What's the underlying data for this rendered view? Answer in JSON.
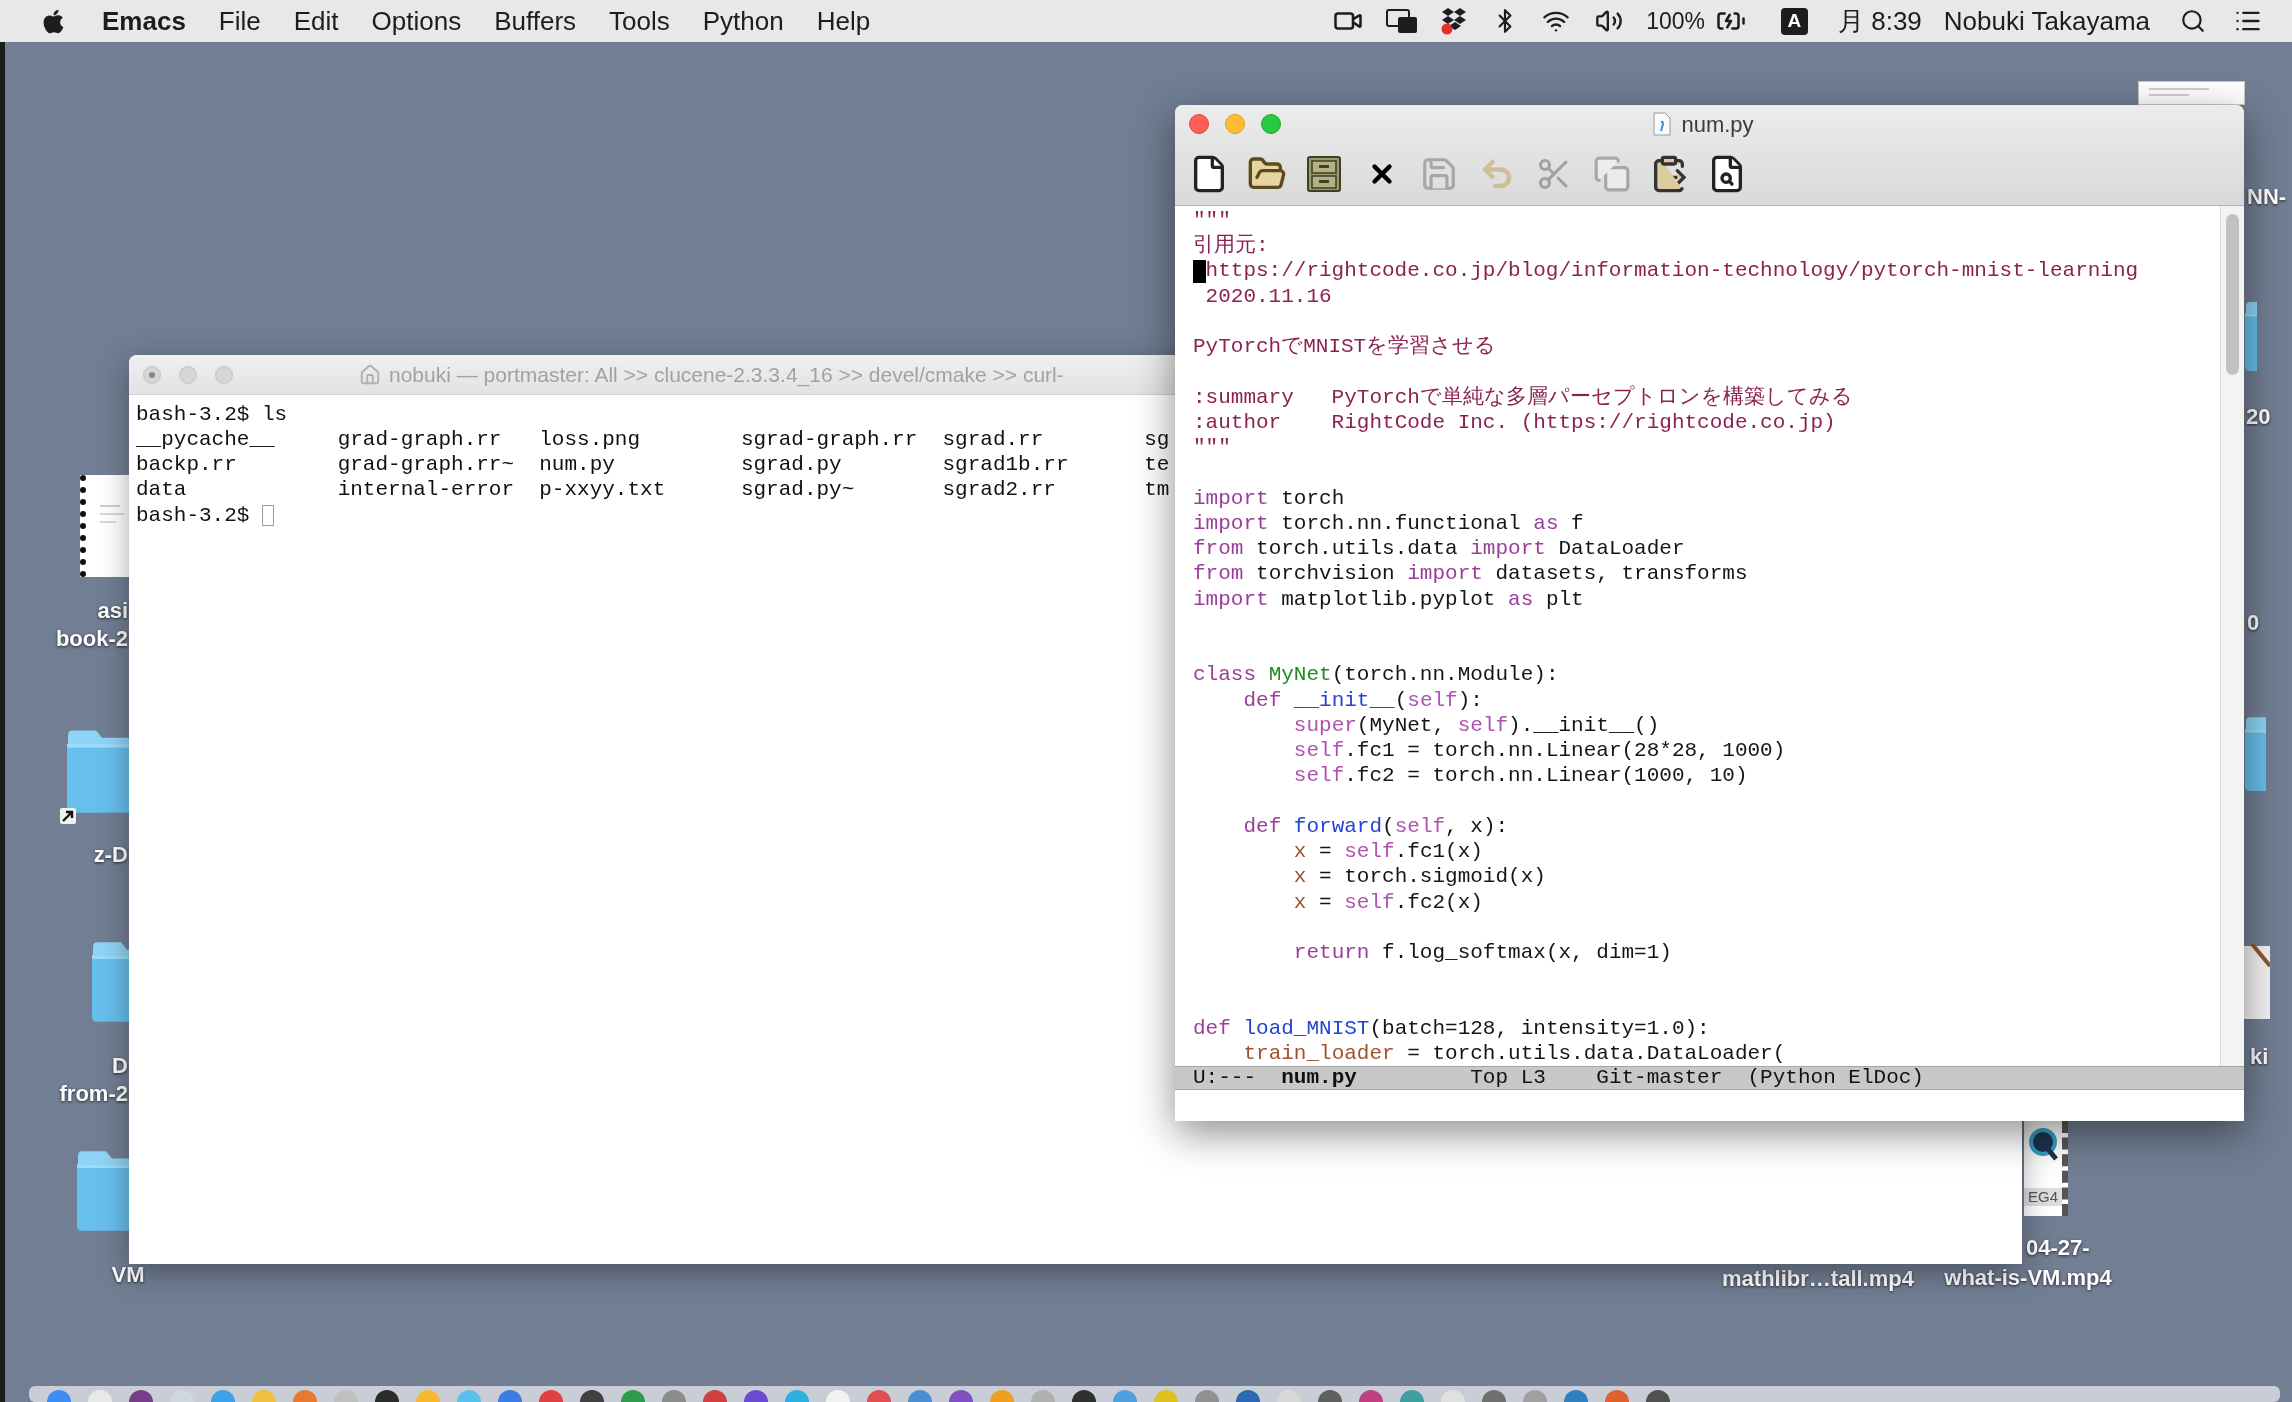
{
  "menu_bar": {
    "app_name": "Emacs",
    "menus": [
      "File",
      "Edit",
      "Options",
      "Buffers",
      "Tools",
      "Python",
      "Help"
    ],
    "battery": "100%",
    "input_source": "A",
    "clock": "月 8:39",
    "user": "Nobuki Takayama"
  },
  "desktop": {
    "left_icons": [
      {
        "kind": "document",
        "label_lines": [
          "asi",
          "book-2"
        ]
      },
      {
        "kind": "alias_folder",
        "label_lines": [
          "z-D"
        ]
      },
      {
        "kind": "folder",
        "label_lines": [
          "D",
          "from-2"
        ]
      },
      {
        "kind": "folder",
        "label_lines": [
          "VM"
        ]
      }
    ],
    "right_edge_items": [
      {
        "kind": "document"
      },
      {
        "kind": "label",
        "text": "NN-"
      },
      {
        "kind": "folder"
      },
      {
        "kind": "label",
        "text": "20"
      },
      {
        "kind": "label",
        "text": "0"
      },
      {
        "kind": "folder"
      },
      {
        "kind": "script"
      },
      {
        "kind": "label",
        "text": "ki"
      }
    ],
    "bottom_items": [
      {
        "kind": "label",
        "label_lines": [
          "mathlibr…tall.mp4"
        ]
      },
      {
        "kind": "video",
        "file_type": "EG4",
        "label_lines": [
          "04-27-",
          "what-is-VM.mp4"
        ]
      }
    ]
  },
  "terminal": {
    "title": "nobuki — portmaster: All >> clucene-2.3.3.4_16 >> devel/cmake >> curl-",
    "active": false,
    "process_running": true,
    "lines": [
      {
        "kind": "command",
        "prompt": "bash-3.2$",
        "command": "ls"
      },
      {
        "kind": "listing",
        "files": [
          "__pycache__",
          "grad-graph.rr",
          "loss.png",
          "sgrad-graph.rr",
          "sgrad.rr",
          "sg"
        ]
      },
      {
        "kind": "listing",
        "files": [
          "backp.rr",
          "grad-graph.rr~",
          "num.py",
          "sgrad.py",
          "sgrad1b.rr",
          "te"
        ]
      },
      {
        "kind": "listing",
        "files": [
          "data",
          "internal-error",
          "p-xxyy.txt",
          "sgrad.py~",
          "sgrad2.rr",
          "tm"
        ]
      },
      {
        "kind": "prompt",
        "prompt": "bash-3.2$"
      }
    ]
  },
  "emacs": {
    "title": "num.py",
    "active": true,
    "toolbar": [
      {
        "kind": "new",
        "disabled": false
      },
      {
        "kind": "open",
        "disabled": false
      },
      {
        "kind": "dired",
        "disabled": false
      },
      {
        "kind": "close",
        "disabled": false
      },
      {
        "kind": "save",
        "disabled": true
      },
      {
        "kind": "undo",
        "disabled": true
      },
      {
        "kind": "cut",
        "disabled": true
      },
      {
        "kind": "copy",
        "disabled": true
      },
      {
        "kind": "paste",
        "disabled": false
      },
      {
        "kind": "search",
        "disabled": false
      }
    ],
    "lines": [
      {
        "kind": "code",
        "tokens": [
          {
            "text": "\"\"\"",
            "kind": "string"
          }
        ]
      },
      {
        "kind": "code",
        "tokens": [
          {
            "text": "引用元:",
            "kind": "string"
          }
        ]
      },
      {
        "kind": "code",
        "tokens": [
          {
            "kind": "cursor"
          },
          {
            "text": "https://rightcode.co.jp/blog/information-technology/pytorch-mnist-learning",
            "kind": "string"
          }
        ]
      },
      {
        "kind": "code",
        "tokens": [
          {
            "text": " 2020.11.16",
            "kind": "string"
          }
        ]
      },
      {
        "kind": "blank"
      },
      {
        "kind": "code",
        "tokens": [
          {
            "text": "PyTorchでMNISTを学習させる",
            "kind": "string"
          }
        ]
      },
      {
        "kind": "blank"
      },
      {
        "kind": "code",
        "tokens": [
          {
            "text": ":summary   PyTorchで単純な多層パーセプトロンを構築してみる",
            "kind": "string"
          }
        ]
      },
      {
        "kind": "code",
        "tokens": [
          {
            "text": ":author    RightCode Inc. (https://rightcode.co.jp)",
            "kind": "string"
          }
        ]
      },
      {
        "kind": "code",
        "tokens": [
          {
            "text": "\"\"\"",
            "kind": "string"
          }
        ]
      },
      {
        "kind": "blank"
      },
      {
        "kind": "code",
        "tokens": [
          {
            "text": "import",
            "kind": "keyword"
          },
          {
            "text": " torch",
            "kind": "plain"
          }
        ]
      },
      {
        "kind": "code",
        "tokens": [
          {
            "text": "import",
            "kind": "keyword"
          },
          {
            "text": " torch.nn.functional ",
            "kind": "plain"
          },
          {
            "text": "as",
            "kind": "keyword"
          },
          {
            "text": " f",
            "kind": "plain"
          }
        ]
      },
      {
        "kind": "code",
        "tokens": [
          {
            "text": "from",
            "kind": "keyword"
          },
          {
            "text": " torch.utils.data ",
            "kind": "plain"
          },
          {
            "text": "import",
            "kind": "keyword"
          },
          {
            "text": " DataLoader",
            "kind": "plain"
          }
        ]
      },
      {
        "kind": "code",
        "tokens": [
          {
            "text": "from",
            "kind": "keyword"
          },
          {
            "text": " torchvision ",
            "kind": "plain"
          },
          {
            "text": "import",
            "kind": "keyword"
          },
          {
            "text": " datasets, transforms",
            "kind": "plain"
          }
        ]
      },
      {
        "kind": "code",
        "tokens": [
          {
            "text": "import",
            "kind": "keyword"
          },
          {
            "text": " matplotlib.pyplot ",
            "kind": "plain"
          },
          {
            "text": "as",
            "kind": "keyword"
          },
          {
            "text": " plt",
            "kind": "plain"
          }
        ]
      },
      {
        "kind": "blank"
      },
      {
        "kind": "blank"
      },
      {
        "kind": "code",
        "tokens": [
          {
            "text": "class ",
            "kind": "keyword"
          },
          {
            "text": "MyNet",
            "kind": "type"
          },
          {
            "text": "(torch.nn.Module):",
            "kind": "plain"
          }
        ]
      },
      {
        "kind": "code",
        "tokens": [
          {
            "text": "    def ",
            "kind": "keyword"
          },
          {
            "text": "__init__",
            "kind": "function"
          },
          {
            "text": "(",
            "kind": "plain"
          },
          {
            "text": "self",
            "kind": "builtin"
          },
          {
            "text": "):",
            "kind": "plain"
          }
        ]
      },
      {
        "kind": "code",
        "tokens": [
          {
            "text": "        super",
            "kind": "builtin"
          },
          {
            "text": "(MyNet, ",
            "kind": "plain"
          },
          {
            "text": "self",
            "kind": "builtin"
          },
          {
            "text": ").__init__()",
            "kind": "plain"
          }
        ]
      },
      {
        "kind": "code",
        "tokens": [
          {
            "text": "        self",
            "kind": "builtin"
          },
          {
            "text": ".fc1 = torch.nn.Linear(28*28, 1000)",
            "kind": "plain"
          }
        ]
      },
      {
        "kind": "code",
        "tokens": [
          {
            "text": "        self",
            "kind": "builtin"
          },
          {
            "text": ".fc2 = torch.nn.Linear(1000, 10)",
            "kind": "plain"
          }
        ]
      },
      {
        "kind": "blank"
      },
      {
        "kind": "code",
        "tokens": [
          {
            "text": "    def ",
            "kind": "keyword"
          },
          {
            "text": "forward",
            "kind": "function"
          },
          {
            "text": "(",
            "kind": "plain"
          },
          {
            "text": "self",
            "kind": "builtin"
          },
          {
            "text": ", x):",
            "kind": "plain"
          }
        ]
      },
      {
        "kind": "code",
        "tokens": [
          {
            "text": "        x",
            "kind": "variable"
          },
          {
            "text": " = ",
            "kind": "plain"
          },
          {
            "text": "self",
            "kind": "builtin"
          },
          {
            "text": ".fc1(x)",
            "kind": "plain"
          }
        ]
      },
      {
        "kind": "code",
        "tokens": [
          {
            "text": "        x",
            "kind": "variable"
          },
          {
            "text": " = torch.sigmoid(x)",
            "kind": "plain"
          }
        ]
      },
      {
        "kind": "code",
        "tokens": [
          {
            "text": "        x",
            "kind": "variable"
          },
          {
            "text": " = ",
            "kind": "plain"
          },
          {
            "text": "self",
            "kind": "builtin"
          },
          {
            "text": ".fc2(x)",
            "kind": "plain"
          }
        ]
      },
      {
        "kind": "blank"
      },
      {
        "kind": "code",
        "tokens": [
          {
            "text": "        return",
            "kind": "keyword"
          },
          {
            "text": " f.log_softmax(x, dim=1)",
            "kind": "plain"
          }
        ]
      },
      {
        "kind": "blank"
      },
      {
        "kind": "blank"
      },
      {
        "kind": "code",
        "tokens": [
          {
            "text": "def ",
            "kind": "keyword"
          },
          {
            "text": "load_MNIST",
            "kind": "function"
          },
          {
            "text": "(batch=128, intensity=1.0):",
            "kind": "plain"
          }
        ]
      },
      {
        "kind": "code",
        "tokens": [
          {
            "text": "    train_loader",
            "kind": "variable"
          },
          {
            "text": " = torch.utils.data.DataLoader(",
            "kind": "plain"
          }
        ]
      }
    ],
    "mode_line": {
      "status": "U:---",
      "buffer": "num.py",
      "position": "Top L3",
      "branch": "Git-master",
      "modes": "(Python ElDoc)"
    }
  }
}
